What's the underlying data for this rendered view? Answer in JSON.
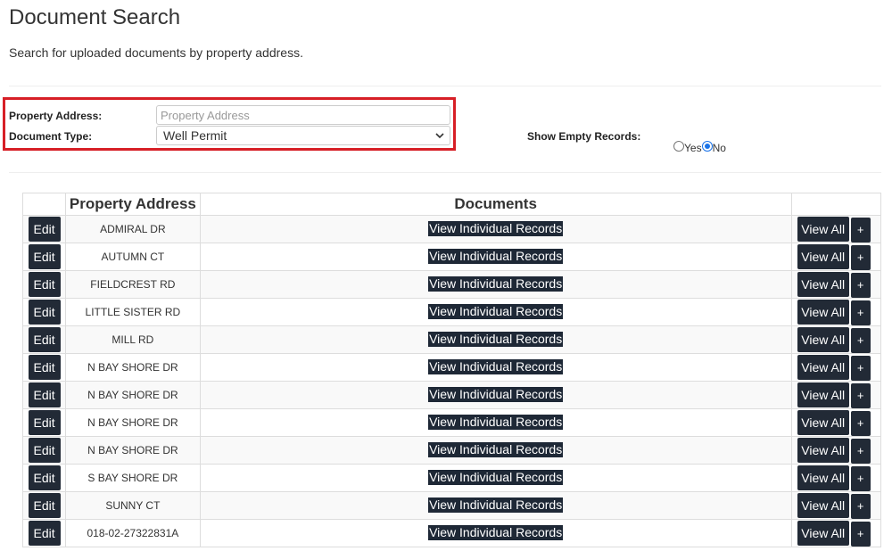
{
  "page": {
    "title": "Document Search",
    "subtitle": "Search for uploaded documents by property address."
  },
  "form": {
    "address_label": "Property Address:",
    "address_placeholder": "Property Address",
    "address_value": "",
    "doc_type_label": "Document Type:",
    "doc_type_selected": "Well Permit",
    "show_empty_label": "Show Empty Records:",
    "show_empty_options": [
      {
        "label": "Yes",
        "checked": false
      },
      {
        "label": "No",
        "checked": true
      }
    ],
    "highlight_color": "#d71f26"
  },
  "table": {
    "headers": [
      "",
      "Property Address",
      "Documents",
      ""
    ],
    "edit_label": "Edit",
    "view_records_label": "View Individual Records",
    "view_all_label": "View All",
    "plus_label": "+",
    "button_color": "#222a36",
    "rows": [
      {
        "address": "ADMIRAL DR"
      },
      {
        "address": "AUTUMN CT"
      },
      {
        "address": "FIELDCREST RD"
      },
      {
        "address": "LITTLE SISTER RD"
      },
      {
        "address": "MILL RD"
      },
      {
        "address": "N BAY SHORE DR"
      },
      {
        "address": "N BAY SHORE DR"
      },
      {
        "address": "N BAY SHORE DR"
      },
      {
        "address": "N BAY SHORE DR"
      },
      {
        "address": "S BAY SHORE DR"
      },
      {
        "address": "SUNNY CT"
      },
      {
        "address": "018-02-27322831A"
      }
    ]
  }
}
